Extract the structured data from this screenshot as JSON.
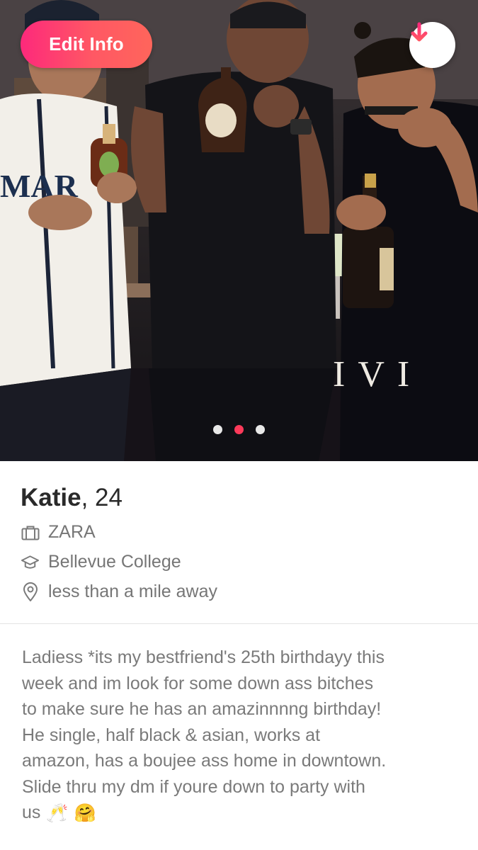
{
  "photo": {
    "edit_button_label": "Edit Info",
    "collapse_icon": "arrow-down-icon",
    "jersey_text": "MAR",
    "shirt_text": "IVI",
    "pagination": {
      "total": 3,
      "active_index": 1
    }
  },
  "profile": {
    "name": "Katie",
    "age": ", 24",
    "job": {
      "icon": "briefcase-icon",
      "text": "ZARA"
    },
    "school": {
      "icon": "graduation-cap-icon",
      "text": "Bellevue College"
    },
    "distance": {
      "icon": "location-pin-icon",
      "text": "less than a mile away"
    }
  },
  "bio": {
    "text": "Ladiess *its my bestfriend's 25th birthdayy this\nweek and im look for some down ass bitches\nto make sure he has an amazinnnng birthday!\nHe single, half black & asian, works at\namazon, has a boujee ass home in downtown.\nSlide thru my dm if youre down to party with\nus",
    "emojis": [
      "🥂",
      "🤗"
    ]
  },
  "colors": {
    "accent_gradient_start": "#fd297b",
    "accent_gradient_end": "#ff655b",
    "active_dot": "#fd3a5a",
    "text_primary": "#2a2a2a",
    "text_secondary": "#767676"
  }
}
